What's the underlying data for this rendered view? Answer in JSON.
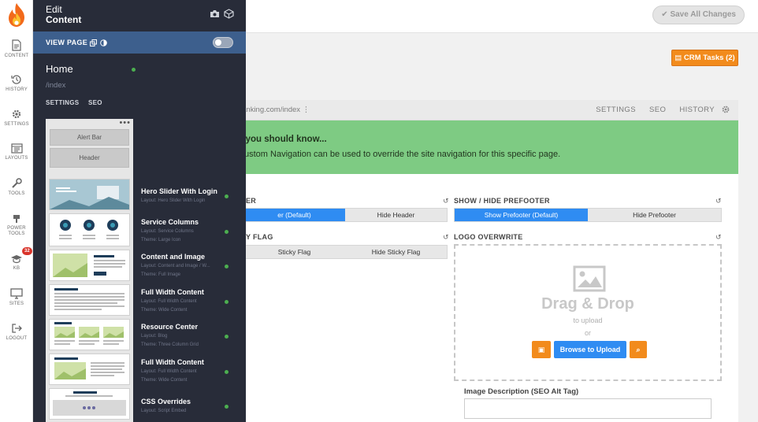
{
  "rail": {
    "items": [
      {
        "label": "CONTENT",
        "icon": "document-icon"
      },
      {
        "label": "HISTORY",
        "icon": "history-icon"
      },
      {
        "label": "SETTINGS",
        "icon": "gear-icon"
      },
      {
        "label": "LAYOUTS",
        "icon": "layout-icon"
      },
      {
        "label": "TOOLS",
        "icon": "wrench-icon"
      },
      {
        "label": "POWER TOOLS",
        "icon": "power-tools-icon"
      },
      {
        "label": "KB",
        "icon": "graduation-cap-icon",
        "badge": "32"
      },
      {
        "label": "SITES",
        "icon": "monitor-icon"
      },
      {
        "label": "LOGOUT",
        "icon": "logout-icon"
      }
    ]
  },
  "header": {
    "save_label": "Save All Changes",
    "crm_label": "CRM Tasks (2)"
  },
  "panel": {
    "title_line1": "Edit",
    "title_line2": "Content",
    "view_page_label": "VIEW PAGE",
    "page_name": "Home",
    "page_path": "/index",
    "tabs": [
      "SETTINGS",
      "SEO"
    ],
    "top_blocks": [
      "Alert Bar",
      "Header"
    ],
    "blocks": [
      {
        "name": "Hero Slider With Login",
        "layout": "Layout: Hero Slider With Login",
        "theme": ""
      },
      {
        "name": "Service Columns",
        "layout": "Layout: Service Columns",
        "theme": "Theme: Large Icon"
      },
      {
        "name": "Content and Image",
        "layout": "Layout: Content and Image / W...",
        "theme": "Theme: Full Image"
      },
      {
        "name": "Full Width Content",
        "layout": "Layout: Full Width Content",
        "theme": "Theme: Wide Content"
      },
      {
        "name": "Resource Center",
        "layout": "Layout: Blog",
        "theme": "Theme: Three Column Grid"
      },
      {
        "name": "Full Width Content",
        "layout": "Layout: Full Width Content",
        "theme": "Theme: Wide Content"
      },
      {
        "name": "CSS Overrides",
        "layout": "Layout: Script Embed",
        "theme": ""
      }
    ]
  },
  "main": {
    "url_text": "rgiabanking.com/index",
    "tabs": [
      "SETTINGS",
      "SEO",
      "HISTORY"
    ],
    "notice_title": "gs you should know...",
    "notice_text": "ustom Navigation can be used to override the site navigation for this specific page.",
    "header_section": {
      "label": "ER",
      "options": [
        "er (Default)",
        "Hide Header"
      ],
      "selected": 0
    },
    "prefooter_section": {
      "label": "SHOW / HIDE PREFOOTER",
      "options": [
        "Show Prefooter (Default)",
        "Hide Prefooter"
      ],
      "selected": 0
    },
    "sticky_section": {
      "label": "Y FLAG",
      "options": [
        "Sticky Flag",
        "Hide Sticky Flag"
      ]
    },
    "logo_section": {
      "label": "LOGO OVERWRITE",
      "drag_title": "Drag & Drop",
      "to_upload": "to upload",
      "or": "or",
      "browse_label": "Browse to Upload"
    },
    "image_desc_label": "Image Description (SEO Alt Tag)",
    "image_desc_value": ""
  },
  "colors": {
    "panel_bg": "#282c39",
    "view_page_bar": "#3d5f8d",
    "accent_orange": "#f28b1c",
    "accent_blue": "#2f8cf2",
    "notice_green": "#7ecb83",
    "status_dot": "#4caf50"
  }
}
